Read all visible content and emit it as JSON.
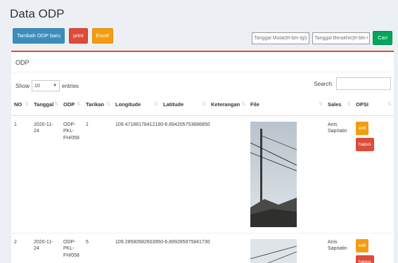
{
  "page": {
    "title": "Data ODP"
  },
  "toolbar": {
    "add_label": "Tambah ODP baru",
    "print_label": "print",
    "excel_label": "Excel"
  },
  "filter": {
    "start_placeholder": "Tanggal Mulai(th-bln-tgl)",
    "end_placeholder": "Tanggal Berakhir(th-bln-tgl)",
    "search_label": "Cari"
  },
  "box": {
    "title": "ODP"
  },
  "entries": {
    "show_label": "Show",
    "selected": "10",
    "entries_label": "entries"
  },
  "search": {
    "label": "Search:"
  },
  "table": {
    "columns": [
      "NO",
      "Tanggal",
      "ODP",
      "Tarikan",
      "Longitude",
      "Latitude",
      "Keterangan",
      "File",
      "Sales",
      "OPSI"
    ],
    "rows": [
      {
        "no": "1",
        "tanggal": "2020-11-24",
        "odp": "ODP-PKL-FH/058",
        "tarikan": "1",
        "longitude": "109.47186178412180",
        "latitude": "-6.894205753686850",
        "keterangan": "",
        "sales": "Anis Sapriatin",
        "edit": "edit",
        "hapus": "hapus"
      },
      {
        "no": "2",
        "tanggal": "2020-11-24",
        "odp": "ODP-PKL-FH/058",
        "tarikan": "5",
        "longitude": "109.28580582603950",
        "latitude": "-6.899285975841730",
        "keterangan": "",
        "sales": "Anis Sapriatin",
        "edit": "edit",
        "hapus": "hapus"
      }
    ]
  },
  "colors": {
    "primary": "#3c8dbc",
    "danger": "#dd4b39",
    "warning": "#f39c12",
    "success": "#00a65a"
  }
}
